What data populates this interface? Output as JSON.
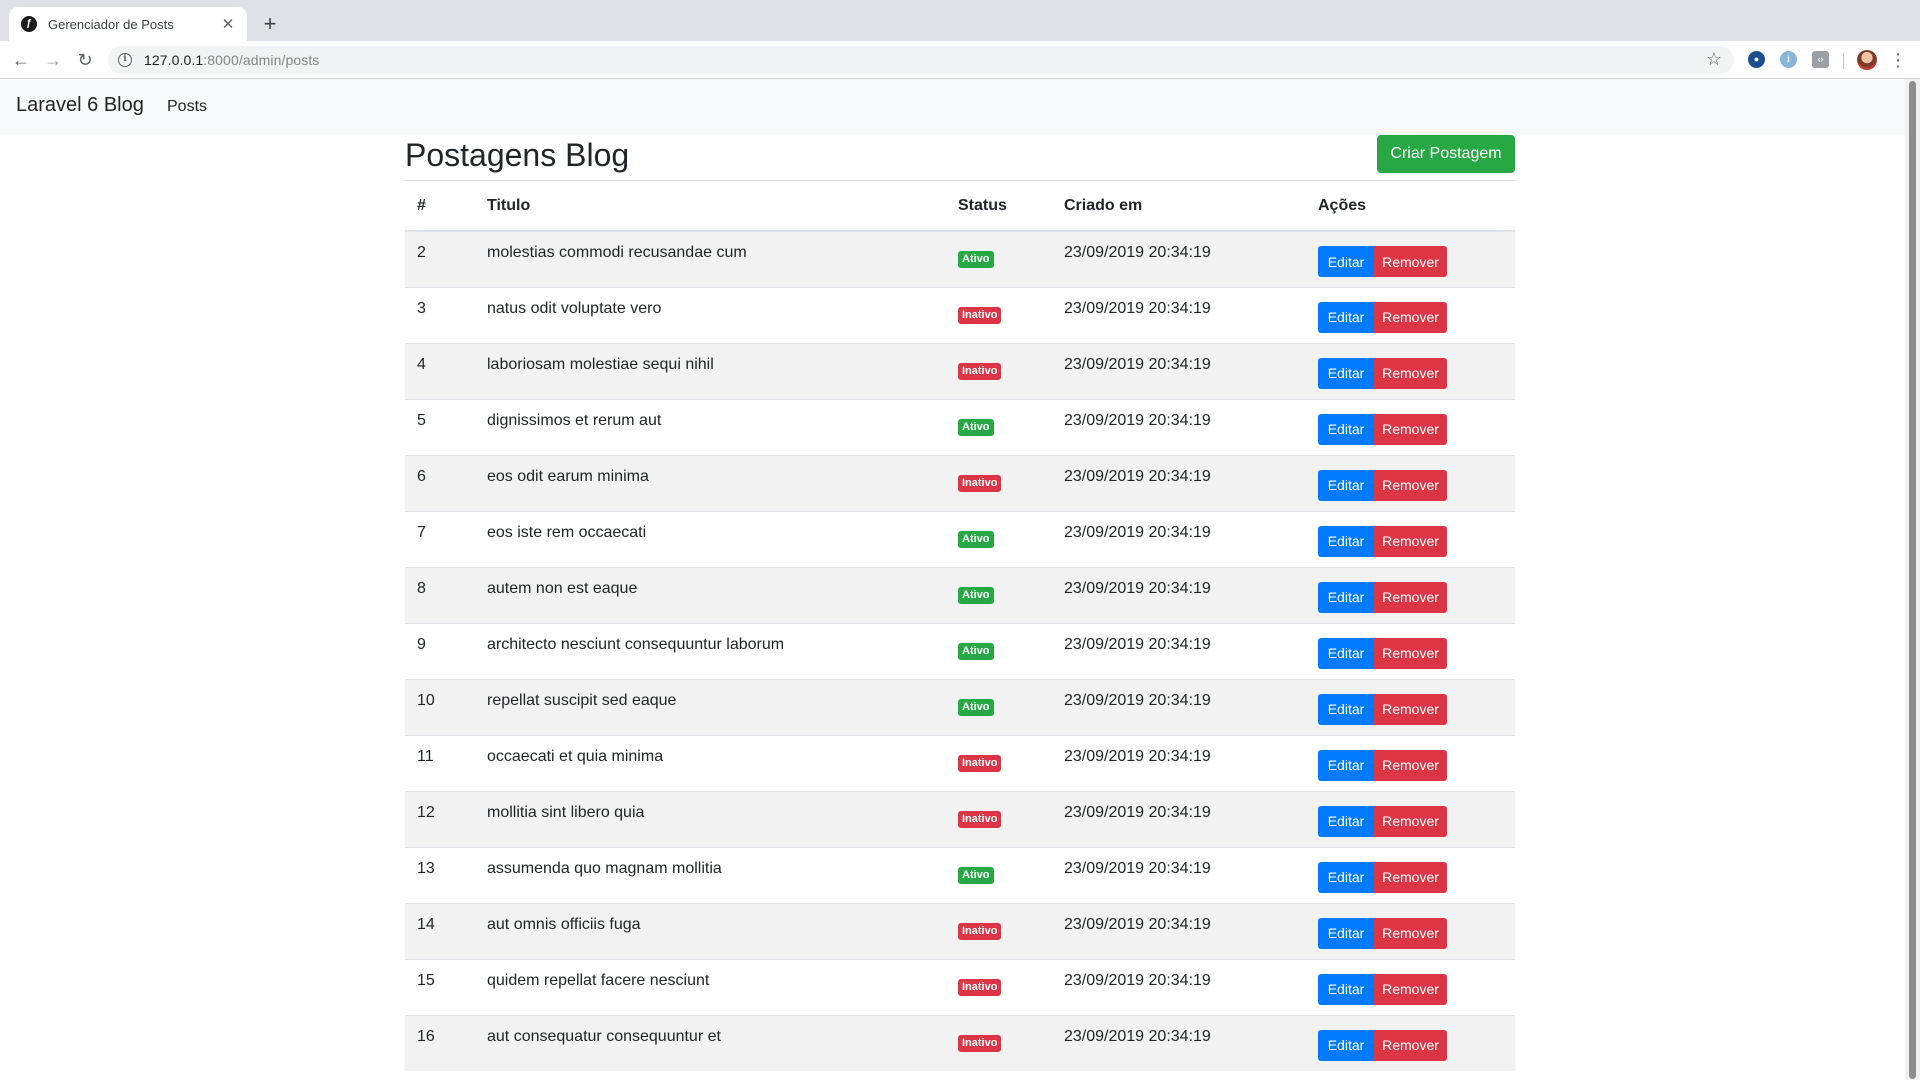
{
  "browser": {
    "tab_title": "Gerenciador de Posts",
    "url_host": "127.0.0.1",
    "url_path": ":8000/admin/posts"
  },
  "navbar": {
    "brand": "Laravel 6 Blog",
    "links": [
      "Posts"
    ]
  },
  "main": {
    "title": "Postagens Blog",
    "create_button": "Criar Postagem",
    "columns": [
      "#",
      "Titulo",
      "Status",
      "Criado em",
      "Ações"
    ],
    "edit_label": "Editar",
    "remove_label": "Remover",
    "rows": [
      {
        "id": "2",
        "title": "molestias commodi recusandae cum",
        "status": "Ativo",
        "created": "23/09/2019 20:34:19"
      },
      {
        "id": "3",
        "title": "natus odit voluptate vero",
        "status": "Inativo",
        "created": "23/09/2019 20:34:19"
      },
      {
        "id": "4",
        "title": "laboriosam molestiae sequi nihil",
        "status": "Inativo",
        "created": "23/09/2019 20:34:19"
      },
      {
        "id": "5",
        "title": "dignissimos et rerum aut",
        "status": "Ativo",
        "created": "23/09/2019 20:34:19"
      },
      {
        "id": "6",
        "title": "eos odit earum minima",
        "status": "Inativo",
        "created": "23/09/2019 20:34:19"
      },
      {
        "id": "7",
        "title": "eos iste rem occaecati",
        "status": "Ativo",
        "created": "23/09/2019 20:34:19"
      },
      {
        "id": "8",
        "title": "autem non est eaque",
        "status": "Ativo",
        "created": "23/09/2019 20:34:19"
      },
      {
        "id": "9",
        "title": "architecto nesciunt consequuntur laborum",
        "status": "Ativo",
        "created": "23/09/2019 20:34:19"
      },
      {
        "id": "10",
        "title": "repellat suscipit sed eaque",
        "status": "Ativo",
        "created": "23/09/2019 20:34:19"
      },
      {
        "id": "11",
        "title": "occaecati et quia minima",
        "status": "Inativo",
        "created": "23/09/2019 20:34:19"
      },
      {
        "id": "12",
        "title": "mollitia sint libero quia",
        "status": "Inativo",
        "created": "23/09/2019 20:34:19"
      },
      {
        "id": "13",
        "title": "assumenda quo magnam mollitia",
        "status": "Ativo",
        "created": "23/09/2019 20:34:19"
      },
      {
        "id": "14",
        "title": "aut omnis officiis fuga",
        "status": "Inativo",
        "created": "23/09/2019 20:34:19"
      },
      {
        "id": "15",
        "title": "quidem repellat facere nesciunt",
        "status": "Inativo",
        "created": "23/09/2019 20:34:19"
      },
      {
        "id": "16",
        "title": "aut consequatur consequuntur et",
        "status": "Inativo",
        "created": "23/09/2019 20:34:19"
      }
    ]
  },
  "icons": {
    "back": "arrow-left-icon",
    "forward": "arrow-right-icon",
    "reload": "reload-icon",
    "site_info": "info-icon",
    "bookmark": "star-icon",
    "menu": "more-vert-icon"
  },
  "colors": {
    "success": "#28a745",
    "danger": "#dc3545",
    "primary": "#007bff"
  }
}
